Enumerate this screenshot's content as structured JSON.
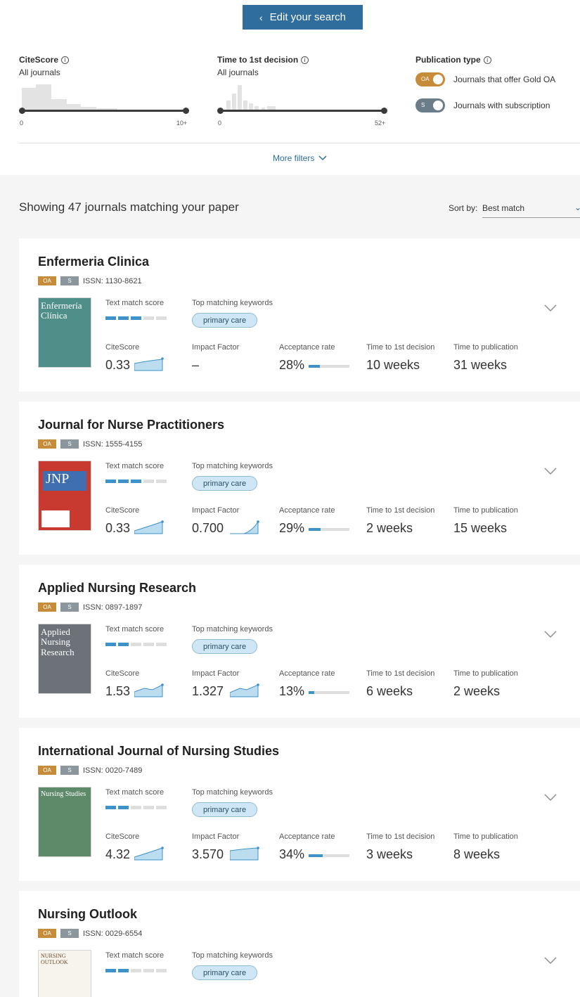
{
  "filters": {
    "edit_label": "Edit your search",
    "citescore": {
      "title": "CiteScore",
      "sub": "All journals",
      "min": "0",
      "max": "10+"
    },
    "decision": {
      "title": "Time to 1st decision",
      "sub": "All journals",
      "min": "0",
      "max": "52+"
    },
    "pubtype": {
      "title": "Publication type",
      "gold_badge": "OA",
      "gold_label": "Journals that offer Gold OA",
      "sub_badge": "S",
      "sub_label": "Journals with subscription"
    },
    "more_label": "More filters"
  },
  "results": {
    "showing": "Showing 47 journals matching your paper",
    "sort_label": "Sort by:",
    "sort_value": "Best match"
  },
  "labels": {
    "oa": "OA",
    "s": "S",
    "text_match": "Text match score",
    "keywords": "Top matching keywords",
    "citescore": "CiteScore",
    "impact": "Impact Factor",
    "acceptance": "Acceptance rate",
    "decision": "Time to 1st decision",
    "publication": "Time to publication"
  },
  "journals": [
    {
      "title": "Enfermeria Clinica",
      "issn": "ISSN: 1130-8621",
      "score": 3,
      "keyword": "primary care",
      "citescore": "0.33",
      "impact": "–",
      "acceptance": "28%",
      "acceptance_pct": 28,
      "decision": "10 weeks",
      "publication": "31 weeks",
      "cover_text": "Enfermería Clínica",
      "cover_color": "#4f8f8a"
    },
    {
      "title": "Journal for Nurse Practitioners",
      "issn": "ISSN: 1555-4155",
      "score": 3,
      "keyword": "primary care",
      "citescore": "0.33",
      "impact": "0.700",
      "acceptance": "29%",
      "acceptance_pct": 29,
      "decision": "2 weeks",
      "publication": "15 weeks",
      "cover_text": "JNP",
      "cover_color": "#c8392f"
    },
    {
      "title": "Applied Nursing Research",
      "issn": "ISSN: 0897-1897",
      "score": 2,
      "keyword": "primary care",
      "citescore": "1.53",
      "impact": "1.327",
      "acceptance": "13%",
      "acceptance_pct": 13,
      "decision": "6 weeks",
      "publication": "2 weeks",
      "cover_text": "Applied Nursing Research",
      "cover_color": "#6c7278"
    },
    {
      "title": "International Journal of Nursing Studies",
      "issn": "ISSN: 0020-7489",
      "score": 2,
      "keyword": "primary care",
      "citescore": "4.32",
      "impact": "3.570",
      "acceptance": "34%",
      "acceptance_pct": 34,
      "decision": "3 weeks",
      "publication": "8 weeks",
      "cover_text": "Nursing Studies",
      "cover_color": "#5e8a6a"
    },
    {
      "title": "Nursing Outlook",
      "issn": "ISSN: 0029-6554",
      "score": 2,
      "keyword": "primary care",
      "citescore": "",
      "impact": "",
      "acceptance": "",
      "acceptance_pct": 0,
      "decision": "",
      "publication": "",
      "cover_text": "NURSING OUTLOOK",
      "cover_color": "#8a6a3c"
    }
  ],
  "colors": {
    "accent": "#2e6d9c",
    "gold_oa": "#c68b3b",
    "subscription": "#6a7d88",
    "bar_fill": "#3d92c8"
  }
}
